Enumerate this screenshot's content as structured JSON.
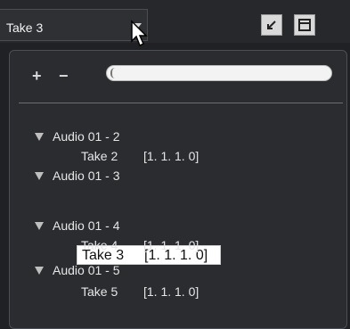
{
  "header": {
    "take_selector_value": "Take 3"
  },
  "panel": {
    "plus_label": "+",
    "minus_label": "−",
    "search_value": "",
    "groups": [
      {
        "label": "Audio 01 - 2",
        "take": "Take 2",
        "position": "[1. 1. 1.  0]"
      },
      {
        "label": "Audio 01 - 3",
        "take": "Take 3",
        "position": "[1. 1. 1.  0]"
      },
      {
        "label": "Audio 01 - 4",
        "take": "Take 4",
        "position": "[1. 1. 1.  0]"
      },
      {
        "label": "Audio 01 - 5",
        "take": "Take 5",
        "position": "[1. 1. 1.  0]"
      }
    ]
  },
  "colors": {
    "background": "#1f2125",
    "panel": "#2a2c30",
    "selection": "#ffffff"
  },
  "icons": {
    "dropdown": "chevron-down-icon",
    "cursor": "mouse-cursor-icon",
    "button_a": "arrow-down-left-icon",
    "button_b": "window-icon"
  }
}
